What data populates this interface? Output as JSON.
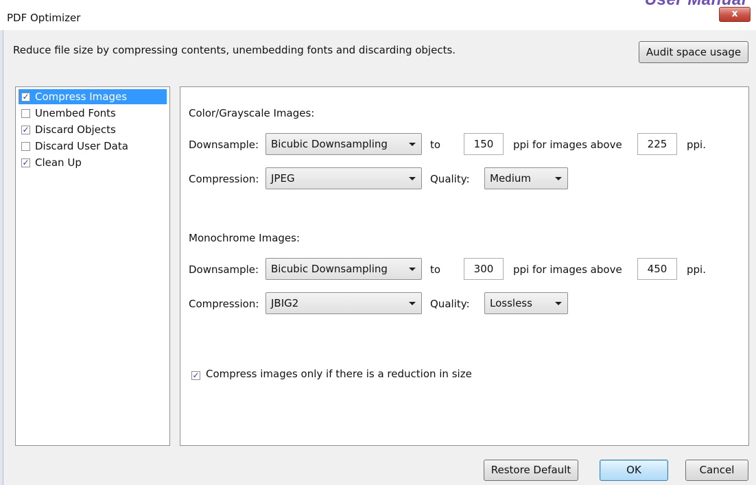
{
  "window": {
    "title": "PDF Optimizer",
    "watermark": "User Manual",
    "close_label": "x"
  },
  "header": {
    "description": "Reduce file size by compressing contents, unembedding fonts and discarding objects.",
    "audit_button": "Audit space usage"
  },
  "sidebar": {
    "items": [
      {
        "label": "Compress Images",
        "checked": true,
        "selected": true
      },
      {
        "label": "Unembed Fonts",
        "checked": false,
        "selected": false
      },
      {
        "label": "Discard Objects",
        "checked": true,
        "selected": false
      },
      {
        "label": "Discard User Data",
        "checked": false,
        "selected": false
      },
      {
        "label": "Clean Up",
        "checked": true,
        "selected": false
      }
    ]
  },
  "color_images": {
    "heading": "Color/Grayscale Images:",
    "downsample_label": "Downsample:",
    "downsample_method": "Bicubic Downsampling",
    "to_label": "to",
    "target_ppi": "150",
    "above_label": "ppi for images above",
    "threshold_ppi": "225",
    "ppi_suffix": "ppi.",
    "compression_label": "Compression:",
    "compression": "JPEG",
    "quality_label": "Quality:",
    "quality": "Medium"
  },
  "mono_images": {
    "heading": "Monochrome Images:",
    "downsample_label": "Downsample:",
    "downsample_method": "Bicubic Downsampling",
    "to_label": "to",
    "target_ppi": "300",
    "above_label": "ppi for images above",
    "threshold_ppi": "450",
    "ppi_suffix": "ppi.",
    "compression_label": "Compression:",
    "compression": "JBIG2",
    "quality_label": "Quality:",
    "quality": "Lossless"
  },
  "reduction_option": {
    "label": "Compress images only if there is a reduction in size",
    "checked": true
  },
  "footer": {
    "restore_button": "Restore Default",
    "ok_button": "OK",
    "cancel_button": "Cancel"
  }
}
